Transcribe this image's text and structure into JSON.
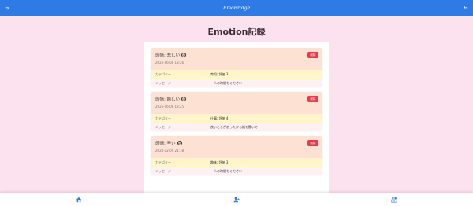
{
  "app": {
    "brand": "EmoBridge",
    "title": "Emotion記録"
  },
  "colors": {
    "topbar": "#2f7be6",
    "background": "#fbe2ee",
    "card_header": "#fde2d4",
    "category_row": "#fff5c9",
    "delete_button": "#e53b4d"
  },
  "records": [
    {
      "emotion": "感情: 悲しい",
      "emoji": "sad-face-icon",
      "emoji_char": "☹",
      "timestamp": "2025-06-08 13:26",
      "delete_label": "削除",
      "category_label": "カテゴリー",
      "category_value": "育児: 評価 3",
      "message_label": "メッセージ",
      "message_value": "一人の時間をください"
    },
    {
      "emotion": "感情: 嬉しい",
      "emoji": "happy-face-icon",
      "emoji_char": "☺",
      "timestamp": "2025-06-08 13:25",
      "delete_label": "削除",
      "category_label": "カテゴリー",
      "category_value": "仕事: 評価 4",
      "message_label": "メッセージ",
      "message_value": "良いことがあったから話を聞いて"
    },
    {
      "emotion": "感情: 辛い",
      "emoji": "pained-face-icon",
      "emoji_char": "☹",
      "timestamp": "2024-12-09 21:18",
      "delete_label": "削除",
      "category_label": "カテゴリー",
      "category_value": "趣味: 評価 3",
      "message_label": "メッセージ",
      "message_value": "一人の時間をください"
    }
  ],
  "nav": {
    "home_icon": "home-icon",
    "user_icon": "user-icon",
    "couple_icon": "couple-icon"
  }
}
